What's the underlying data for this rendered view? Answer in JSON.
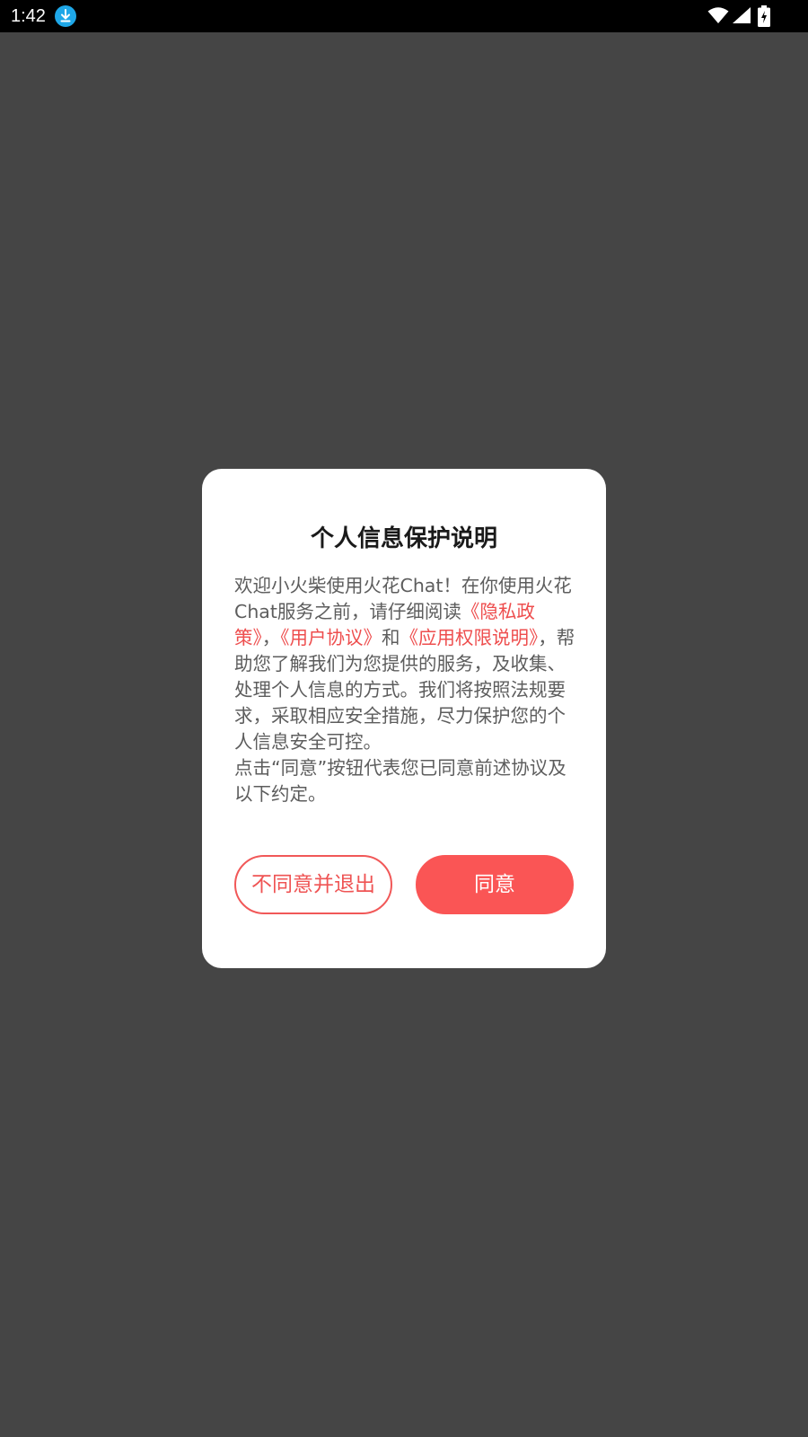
{
  "status_bar": {
    "time": "1:42",
    "icons": [
      "download-icon",
      "wifi-icon",
      "signal-icon",
      "battery-charging-icon"
    ]
  },
  "dialog": {
    "title": "个人信息保护说明",
    "body": {
      "intro": "欢迎小火柴使用火花Chat！在你使用火花Chat服务之前，请仔细阅读",
      "privacy_policy_link": "《隐私政策》",
      "sep1": "，",
      "user_agreement_link": "《用户协议》",
      "sep2": "和",
      "permissions_link": "《应用权限说明》",
      "rest": "，帮助您了解我们为您提供的服务，及收集、处理个人信息的方式。我们将按照法规要求，采取相应安全措施，尽力保护您的个人信息安全可控。",
      "second_paragraph": "点击“同意”按钮代表您已同意前述协议及以下约定。"
    },
    "decline_label": "不同意并退出",
    "agree_label": "同意"
  },
  "colors": {
    "overlay": "#454545",
    "accent": "#fa5555",
    "link": "#ee4e4e",
    "body_text": "#5d5d5d",
    "title_text": "#1a1a1a"
  }
}
